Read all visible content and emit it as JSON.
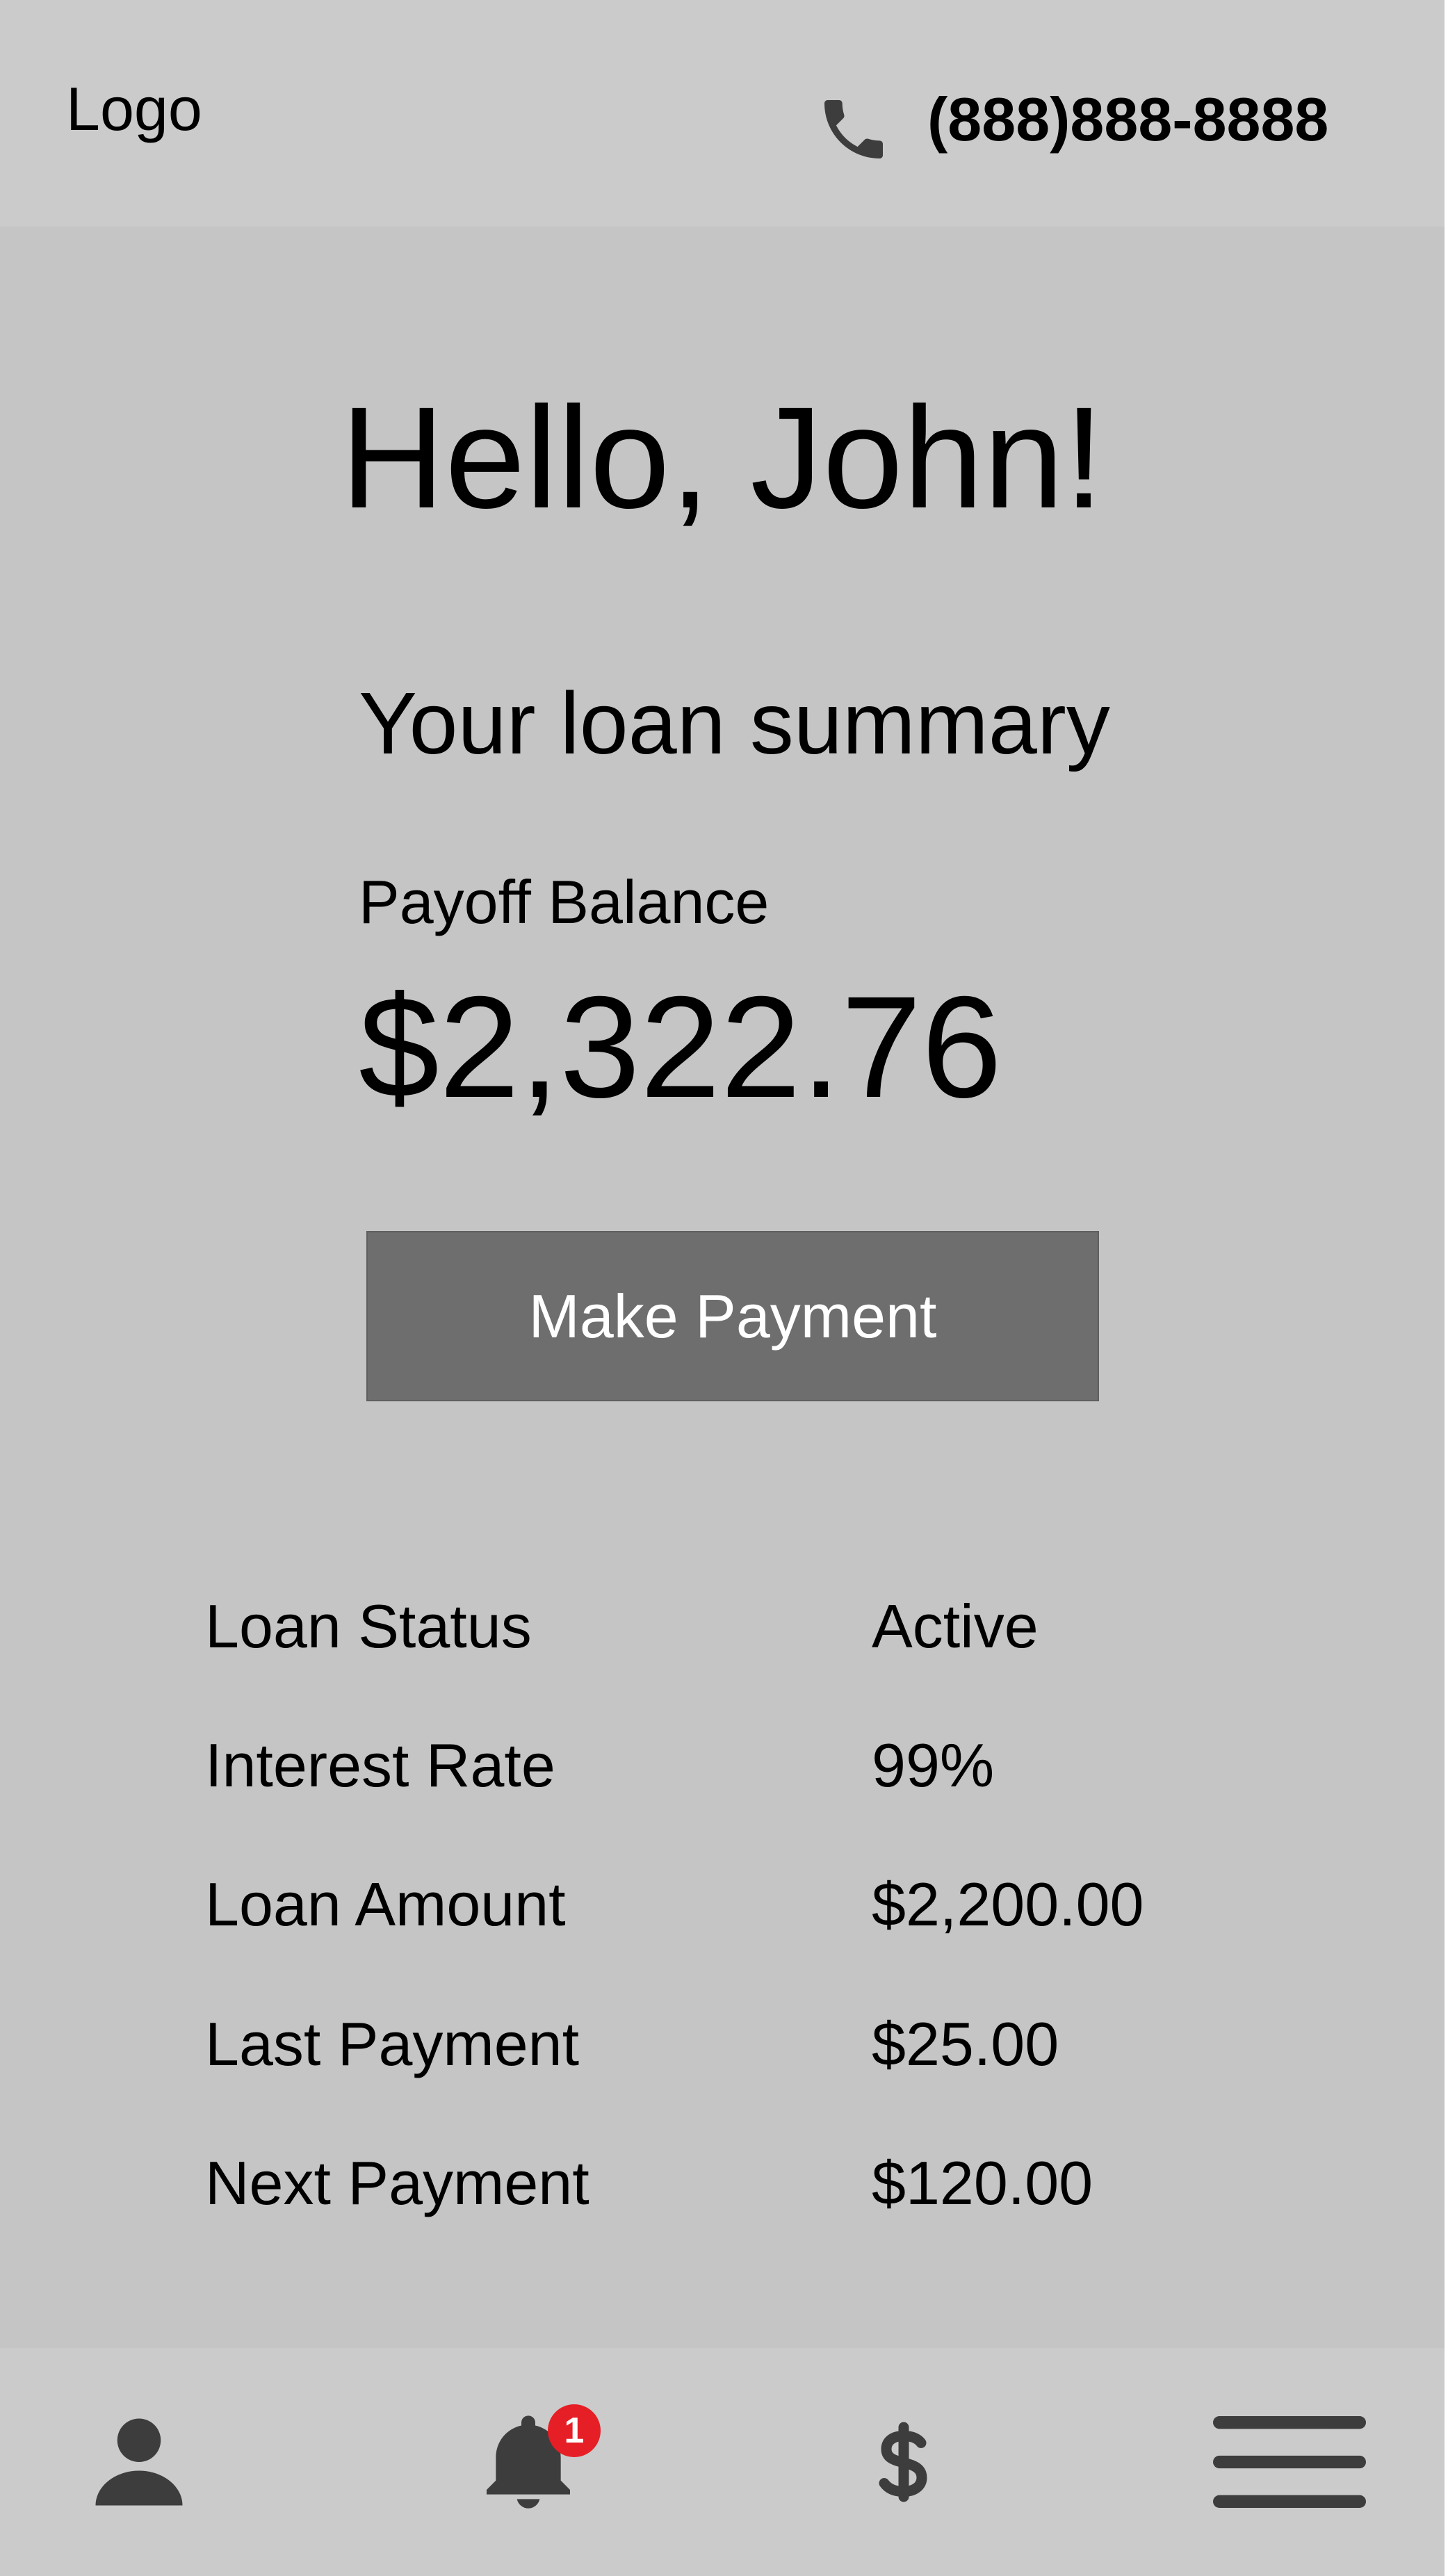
{
  "header": {
    "logo": "Logo",
    "phone_icon": "phone-icon",
    "phone_number": "(888)888-8888"
  },
  "greeting": "Hello, John!",
  "summary": {
    "title": "Your loan summary",
    "payoff_label": "Payoff Balance",
    "payoff_value": "$2,322.76",
    "button_label": "Make Payment"
  },
  "details": [
    {
      "label": "Loan Status",
      "value": "Active"
    },
    {
      "label": "Interest Rate",
      "value": "99%"
    },
    {
      "label": "Loan Amount",
      "value": "$2,200.00"
    },
    {
      "label": "Last Payment",
      "value": "$25.00"
    },
    {
      "label": "Next Payment",
      "value": "$120.00"
    }
  ],
  "nav": {
    "profile_icon": "user-icon",
    "notifications_icon": "bell-icon",
    "notifications_badge": "1",
    "payments_icon": "dollar-icon",
    "menu_icon": "hamburger-menu-icon"
  },
  "colors": {
    "page_background": "#c5c5c5",
    "bar_background": "#cbcbcb",
    "button_background": "#6e6e6e",
    "icon_color": "#3d3d3d",
    "badge_color": "#e61e25"
  }
}
